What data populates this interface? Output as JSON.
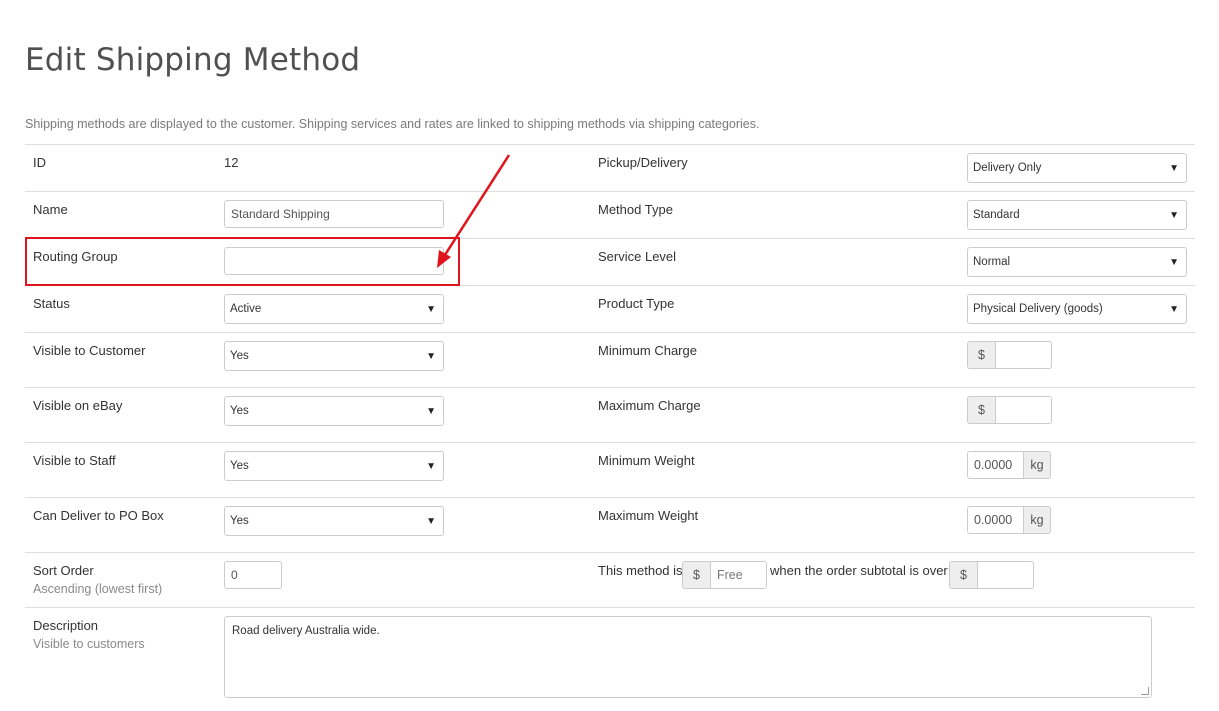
{
  "page": {
    "title": "Edit Shipping Method",
    "intro": "Shipping methods are displayed to the customer. Shipping services and rates are linked to shipping methods via shipping categories."
  },
  "left": {
    "id": {
      "label": "ID",
      "value": "12"
    },
    "name": {
      "label": "Name",
      "value": "Standard Shipping"
    },
    "routing_group": {
      "label": "Routing Group",
      "value": ""
    },
    "status": {
      "label": "Status",
      "value": "Active"
    },
    "visible_customer": {
      "label": "Visible to Customer",
      "value": "Yes"
    },
    "visible_ebay": {
      "label": "Visible on eBay",
      "value": "Yes"
    },
    "visible_staff": {
      "label": "Visible to Staff",
      "value": "Yes"
    },
    "po_box": {
      "label": "Can Deliver to PO Box",
      "value": "Yes"
    },
    "sort_order": {
      "label": "Sort Order",
      "sub": "Ascending (lowest first)",
      "value": "0"
    },
    "description": {
      "label": "Description",
      "sub": "Visible to customers",
      "value": "Road delivery Australia wide."
    }
  },
  "right": {
    "pickup": {
      "label": "Pickup/Delivery",
      "value": "Delivery Only"
    },
    "method_type": {
      "label": "Method Type",
      "value": "Standard"
    },
    "service_level": {
      "label": "Service Level",
      "value": "Normal"
    },
    "product_type": {
      "label": "Product Type",
      "value": "Physical Delivery (goods)"
    },
    "min_charge": {
      "label": "Minimum Charge",
      "prefix": "$",
      "value": ""
    },
    "max_charge": {
      "label": "Maximum Charge",
      "prefix": "$",
      "value": ""
    },
    "min_weight": {
      "label": "Minimum Weight",
      "value": "0.0000",
      "suffix": "kg"
    },
    "max_weight": {
      "label": "Maximum Weight",
      "value": "0.0000",
      "suffix": "kg"
    },
    "free_rule": {
      "label": "This method is",
      "prefix": "$",
      "placeholder": "Free",
      "middle": "when the order subtotal is over",
      "prefix2": "$",
      "value2": ""
    }
  },
  "icons": {
    "dropdown": "▼"
  },
  "colors": {
    "annotation": "#e0141c"
  }
}
